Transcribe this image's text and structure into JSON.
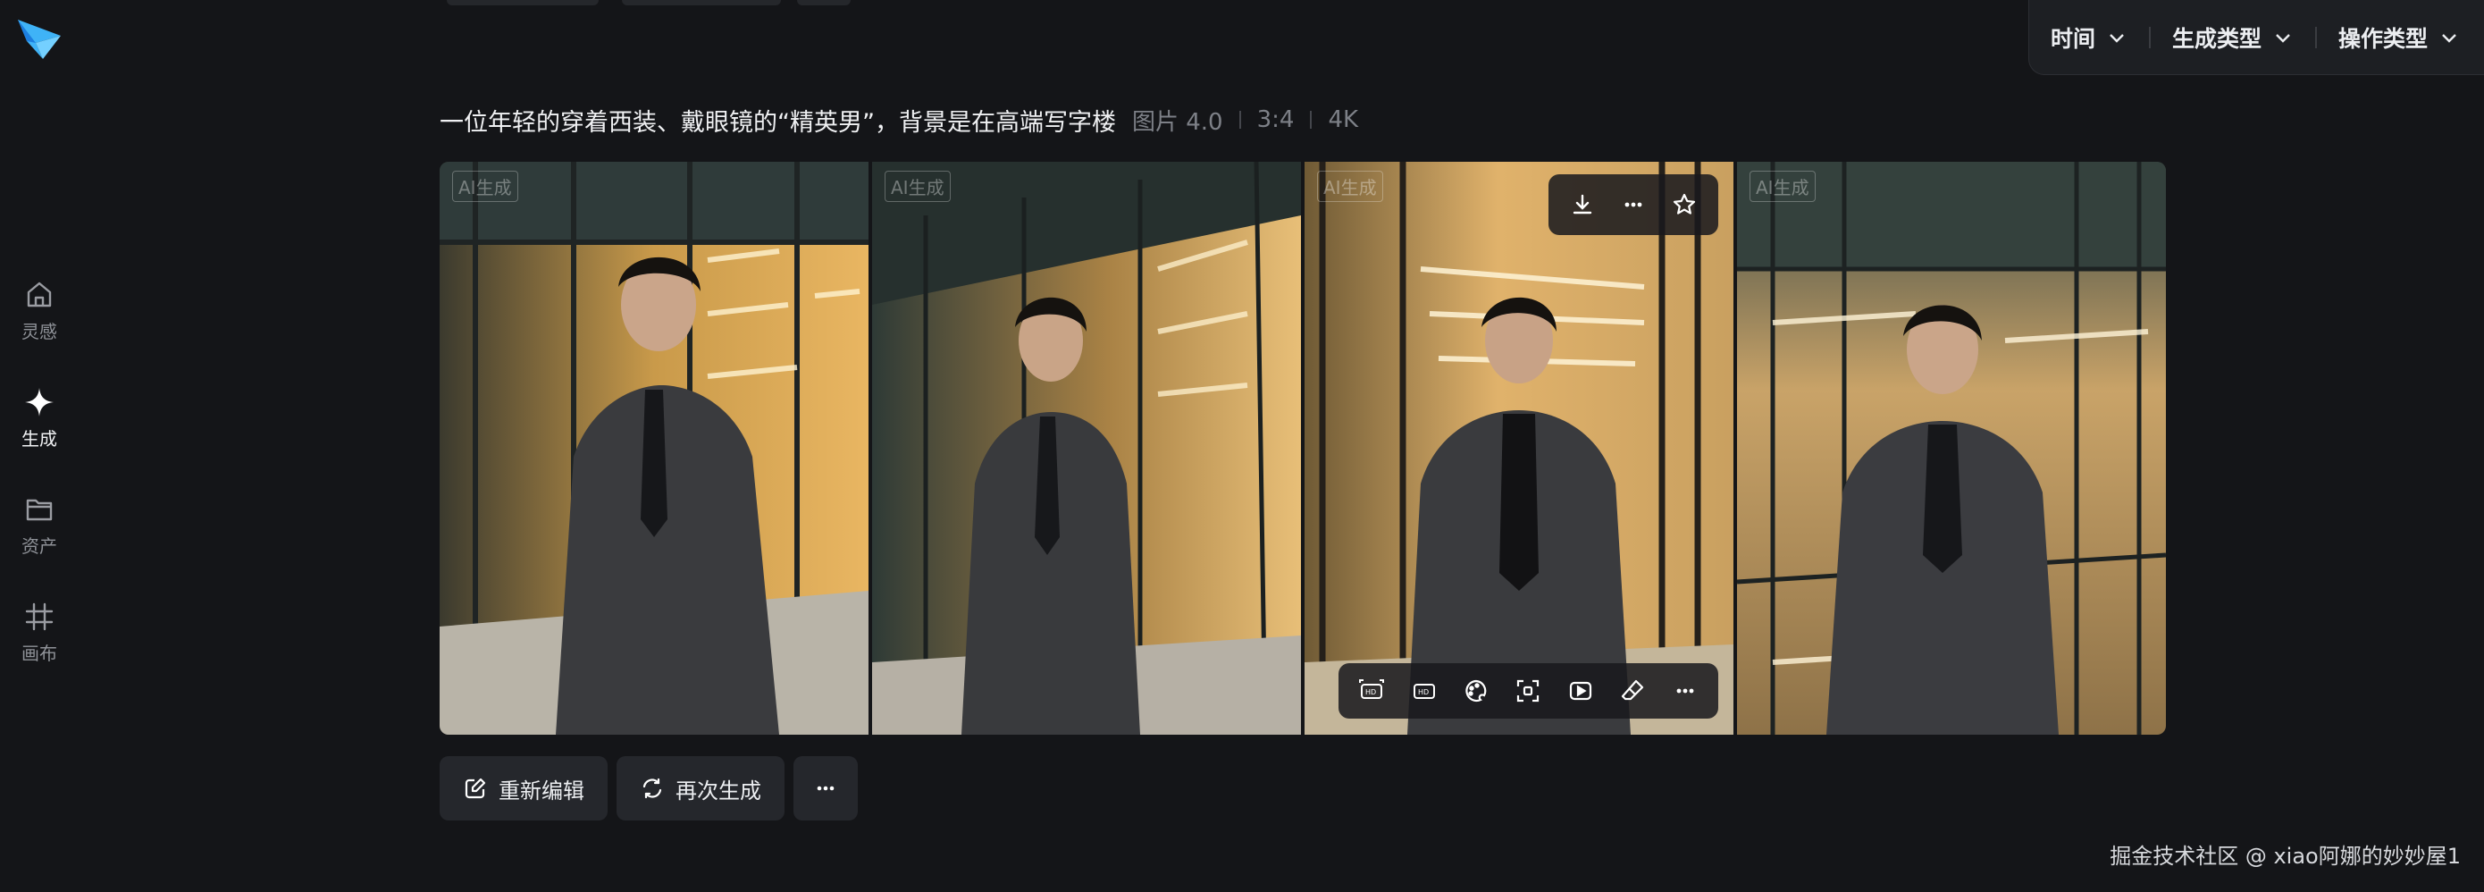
{
  "nav": {
    "items": [
      {
        "label": "灵感",
        "icon": "home-icon"
      },
      {
        "label": "生成",
        "icon": "sparkle-icon",
        "active": true
      },
      {
        "label": "资产",
        "icon": "folder-icon"
      },
      {
        "label": "画布",
        "icon": "frame-icon"
      }
    ]
  },
  "filters": {
    "time": "时间",
    "gen_type": "生成类型",
    "op_type": "操作类型"
  },
  "prompt": {
    "text": "一位年轻的穿着西装、戴眼镜的“精英男”，背景是在高端写字楼",
    "model": "图片 4.0",
    "ratio": "3:4",
    "resolution": "4K"
  },
  "images": {
    "watermark": "AI生成",
    "count": 4
  },
  "hover_toolbar": {
    "top": [
      "download-icon",
      "more-icon",
      "star-icon"
    ],
    "bottom": [
      "hd-expand-icon",
      "hd-icon",
      "palette-icon",
      "focus-icon",
      "play-icon",
      "eraser-icon",
      "more-icon"
    ]
  },
  "actions": {
    "reedit": "重新编辑",
    "regenerate": "再次生成"
  },
  "credit": "掘金技术社区 @ xiao阿娜的妙妙屋1",
  "colors": {
    "background": "#141518",
    "panel": "#1d1f23",
    "button": "#25272c",
    "logo_blue": "#2fa8f5"
  }
}
